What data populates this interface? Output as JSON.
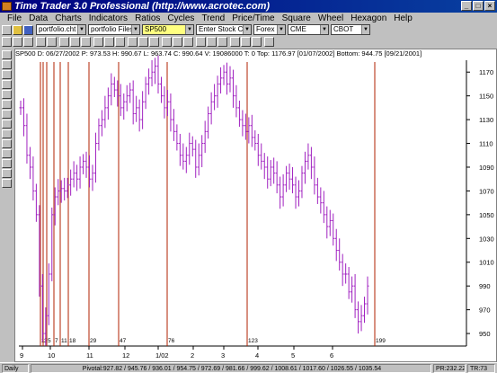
{
  "window": {
    "title": "Time Trader 3.0 Professional (http://www.acrotec.com)",
    "min": "_",
    "max": "□",
    "close": "×"
  },
  "menu": [
    "File",
    "Data",
    "Charts",
    "Indicators",
    "Ratios",
    "Cycles",
    "Trend",
    "Price/Time",
    "Square",
    "Wheel",
    "Hexagon",
    "Help"
  ],
  "toolbar": {
    "portfolio_chart": "portfolio.cht",
    "portfolio_files": "portfolio Files",
    "symbol": "SP500",
    "stock_code": "Enter Stock Code",
    "market": "Forex",
    "exchange": "CME",
    "board": "CBOT"
  },
  "info_line": "SP500  D:  06/27/2002  P: 973.53  H: 990.67  L: 963.74  C: 990.64  V: 19086000  T: 0        Top: 1176.97 [01/07/2002]  Bottom: 944.75 [09/21/2001]",
  "chart_data": {
    "type": "candlestick",
    "symbol": "SP500",
    "period": "Daily",
    "ylim": [
      944,
      1180
    ],
    "y_ticks": [
      950,
      970,
      990,
      1010,
      1030,
      1050,
      1070,
      1090,
      1110,
      1130,
      1150,
      1170
    ],
    "x_ticks": [
      "9",
      "10",
      "11",
      "12",
      "1/02",
      "2",
      "3",
      "4",
      "5",
      "6"
    ],
    "top": {
      "value": 1176.97,
      "date": "01/07/2002"
    },
    "bottom": {
      "value": 944.75,
      "date": "09/21/2001"
    },
    "cycle_labels": [
      "1",
      "3",
      "5",
      "7",
      "11",
      "18",
      "29",
      "47",
      "76",
      "123",
      "199"
    ],
    "price_path": [
      1140,
      1125,
      1100,
      1090,
      1070,
      1050,
      990,
      950,
      965,
      1000,
      1050,
      1065,
      1070,
      1072,
      1070,
      1075,
      1080,
      1085,
      1080,
      1090,
      1095,
      1090,
      1080,
      1085,
      1110,
      1125,
      1130,
      1140,
      1150,
      1160,
      1155,
      1150,
      1140,
      1145,
      1150,
      1155,
      1135,
      1140,
      1130,
      1145,
      1160,
      1165,
      1170,
      1175,
      1160,
      1150,
      1140,
      1145,
      1130,
      1120,
      1110,
      1100,
      1095,
      1100,
      1110,
      1105,
      1090,
      1100,
      1110,
      1120,
      1135,
      1145,
      1150,
      1160,
      1165,
      1170,
      1160,
      1165,
      1150,
      1140,
      1130,
      1125,
      1120,
      1125,
      1115,
      1110,
      1100,
      1095,
      1090,
      1080,
      1090,
      1085,
      1075,
      1065,
      1075,
      1085,
      1080,
      1075,
      1065,
      1070,
      1085,
      1095,
      1100,
      1090,
      1075,
      1065,
      1060,
      1050,
      1040,
      1045,
      1030,
      1020,
      1010,
      1000,
      1000,
      985,
      990,
      970,
      960,
      965,
      975,
      990
    ]
  },
  "status": {
    "period": "Daily",
    "pivots": "Pivotal:927.82 / 945.76 / 936.01 / 954.75 / 972.69 / 981.66 / 999.62 / 1008.61 / 1017.60 / 1026.55 / 1035.54",
    "pr": "PR:232.22",
    "tr": "TR:73"
  }
}
